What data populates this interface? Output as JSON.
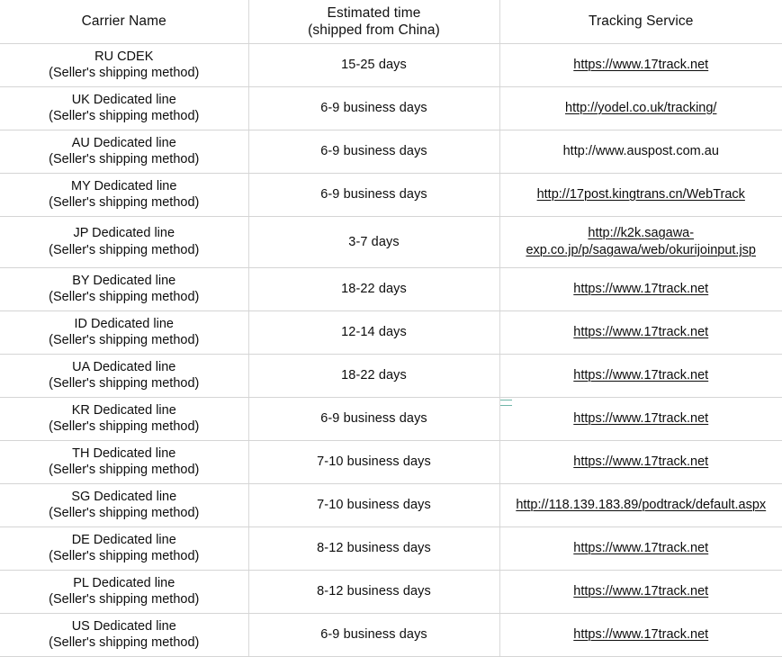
{
  "table": {
    "headers": [
      {
        "line1": "Carrier Name",
        "line2": ""
      },
      {
        "line1": "Estimated time",
        "line2": "(shipped from China)"
      },
      {
        "line1": "Tracking Service",
        "line2": ""
      }
    ],
    "seller_method_note": "(Seller's shipping method)",
    "rows": [
      {
        "carrier": "RU CDEK",
        "sub": "(Seller's shipping method)",
        "time": "15-25 days",
        "tracking_line1": "https://www.17track.net",
        "tracking_line2": "",
        "is_link": true
      },
      {
        "carrier": "UK Dedicated line",
        "sub": "(Seller's shipping method)",
        "time": "6-9 business days",
        "tracking_line1": "http://yodel.co.uk/tracking/",
        "tracking_line2": "",
        "is_link": true
      },
      {
        "carrier": "AU Dedicated line",
        "sub": "(Seller's shipping method)",
        "time": "6-9 business days",
        "tracking_line1": "http://www.auspost.com.au",
        "tracking_line2": "",
        "is_link": false
      },
      {
        "carrier": "MY Dedicated line",
        "sub": "(Seller's shipping method)",
        "time": "6-9 business days",
        "tracking_line1": "http://17post.kingtrans.cn/WebTrack",
        "tracking_line2": "",
        "is_link": true
      },
      {
        "carrier": "JP Dedicated line",
        "sub": "(Seller's shipping method)",
        "time": "3-7 days",
        "tracking_line1": "http://k2k.sagawa-",
        "tracking_line2": "exp.co.jp/p/sagawa/web/okurijoinput.jsp",
        "is_link": true
      },
      {
        "carrier": "BY Dedicated line",
        "sub": "(Seller's shipping method)",
        "time": "18-22 days",
        "tracking_line1": "https://www.17track.net",
        "tracking_line2": "",
        "is_link": true
      },
      {
        "carrier": "ID Dedicated line",
        "sub": "(Seller's shipping method)",
        "time": "12-14 days",
        "tracking_line1": "https://www.17track.net",
        "tracking_line2": "",
        "is_link": true
      },
      {
        "carrier": "UA Dedicated line",
        "sub": "(Seller's shipping method)",
        "time": "18-22 days",
        "tracking_line1": "https://www.17track.net",
        "tracking_line2": "",
        "is_link": true
      },
      {
        "carrier": "KR Dedicated line",
        "sub": "(Seller's shipping method)",
        "time": "6-9 business days",
        "tracking_line1": "https://www.17track.net",
        "tracking_line2": "",
        "is_link": true
      },
      {
        "carrier": "TH Dedicated line",
        "sub": "(Seller's shipping method)",
        "time": "7-10 business days",
        "tracking_line1": "https://www.17track.net",
        "tracking_line2": "",
        "is_link": true
      },
      {
        "carrier": "SG Dedicated line",
        "sub": "(Seller's shipping method)",
        "time": "7-10 business days",
        "tracking_line1": "http://118.139.183.89/podtrack/default.aspx",
        "tracking_line2": "",
        "is_link": true
      },
      {
        "carrier": "DE Dedicated line",
        "sub": "(Seller's shipping method)",
        "time": "8-12 business days",
        "tracking_line1": "https://www.17track.net",
        "tracking_line2": "",
        "is_link": true
      },
      {
        "carrier": "PL Dedicated line",
        "sub": "(Seller's shipping method)",
        "time": "8-12 business days",
        "tracking_line1": "https://www.17track.net",
        "tracking_line2": "",
        "is_link": true
      },
      {
        "carrier": "US Dedicated line",
        "sub": "(Seller's shipping method)",
        "time": "6-9 business days",
        "tracking_line1": "https://www.17track.net",
        "tracking_line2": "",
        "is_link": true
      }
    ]
  },
  "colors": {
    "background": "#ffffff",
    "text": "#0d0d0d",
    "grid_line": "#d5d5d5",
    "column_divider": "#d9d9d9",
    "selection_artifact": "#6fb6a8"
  }
}
